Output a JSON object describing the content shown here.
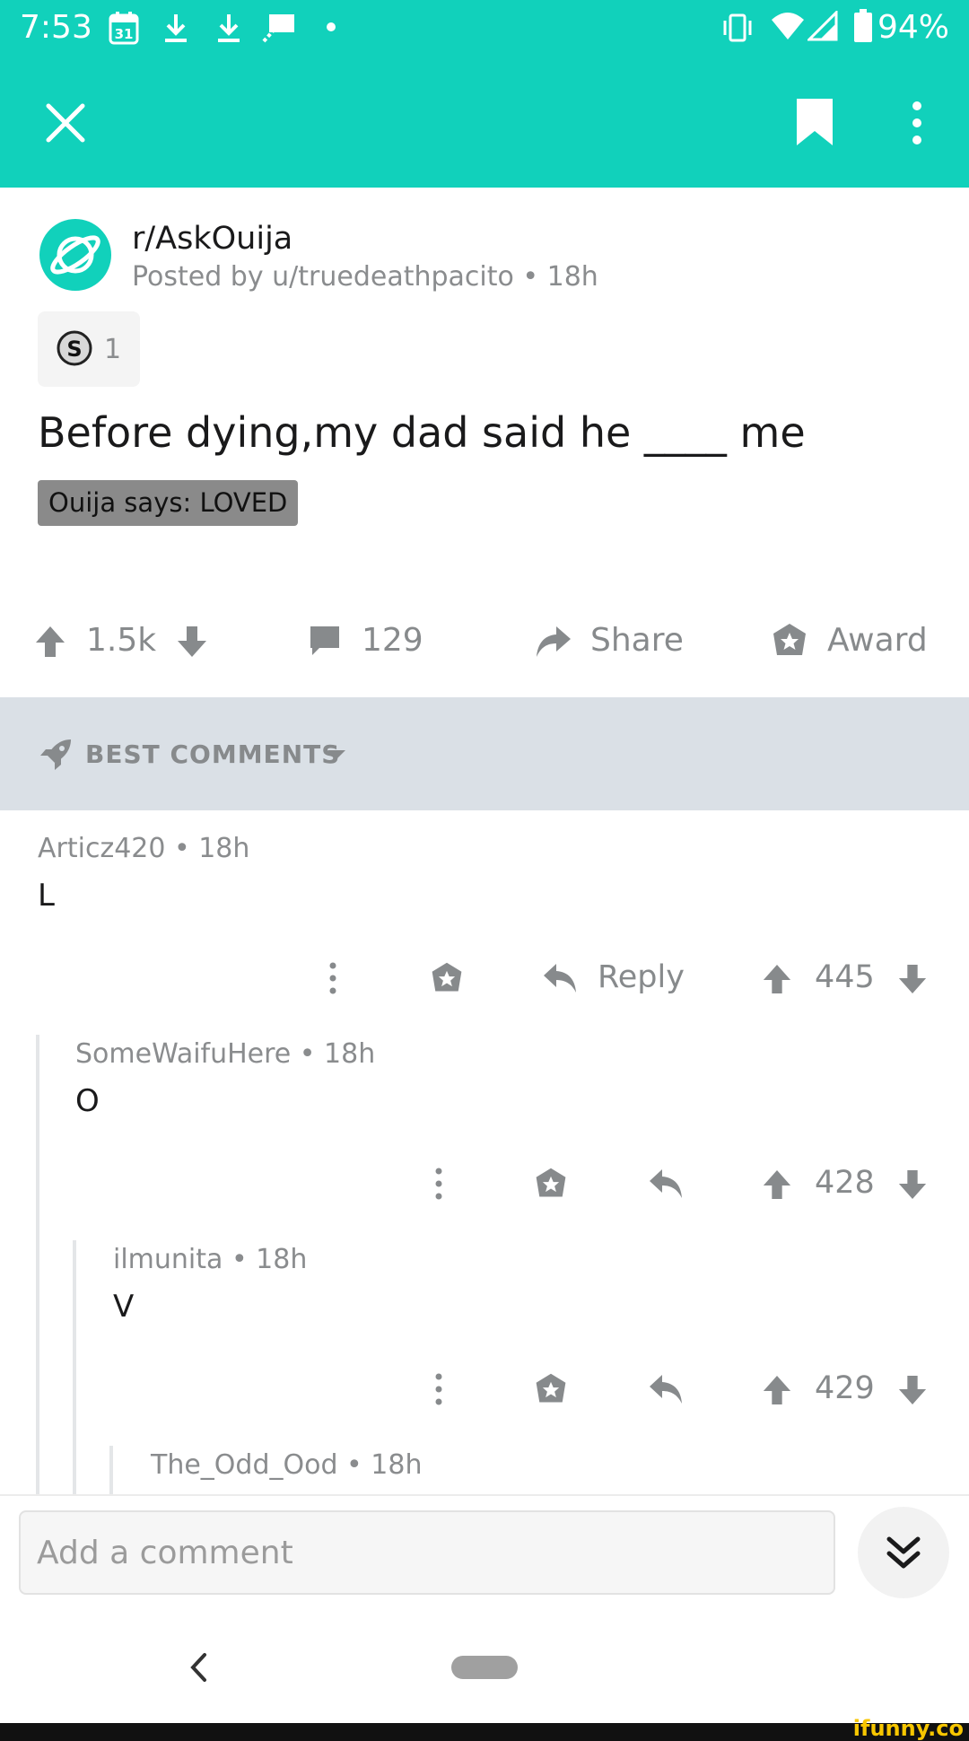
{
  "status_bar": {
    "time": "7:53",
    "battery": "94%",
    "calendar_day": "31"
  },
  "post": {
    "subreddit": "r/AskOuija",
    "posted_by": "Posted by u/truedeathpacito • 18h",
    "award_count": "1",
    "award_glyph": "S",
    "title": "Before dying,my dad said he ____ me",
    "flair": "Ouija says: LOVED",
    "votes": "1.5k",
    "comments_count": "129",
    "share_label": "Share",
    "award_label": "Award"
  },
  "sort": {
    "label": "BEST COMMENTS"
  },
  "comments": [
    {
      "author_meta": "Articz420 • 18h",
      "body": "L",
      "votes": "445",
      "reply_label": "Reply"
    },
    {
      "author_meta": "SomeWaifuHere • 18h",
      "body": "O",
      "votes": "428"
    },
    {
      "author_meta": "ilmunita • 18h",
      "body": "V",
      "votes": "429"
    },
    {
      "author_meta": "The_Odd_Ood • 18h"
    }
  ],
  "composer": {
    "placeholder": "Add a comment"
  },
  "watermark": "ifunny.co",
  "colors": {
    "brand": "#11d1bb",
    "sortbar": "#dae0e6",
    "icon_gray": "#878a8c"
  }
}
